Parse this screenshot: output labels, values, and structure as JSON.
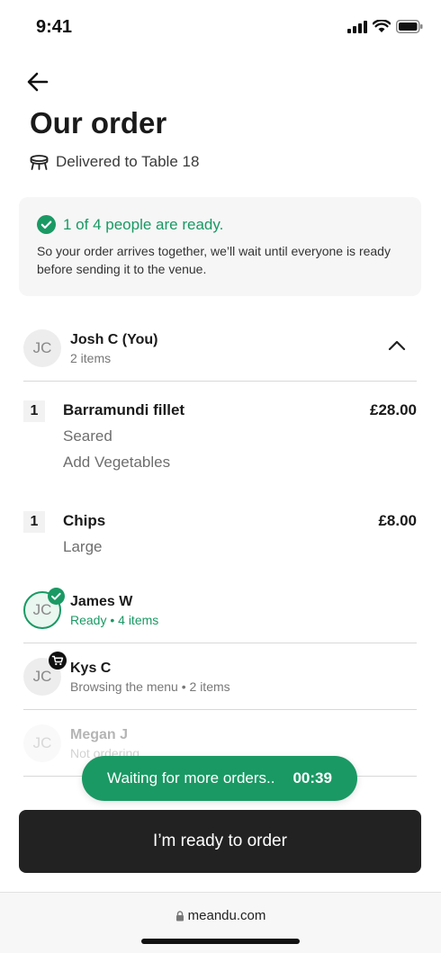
{
  "status_bar": {
    "time": "9:41"
  },
  "header": {
    "title": "Our order",
    "delivery": "Delivered to Table 18"
  },
  "ready_card": {
    "headline": "1 of 4 people are ready.",
    "description": "So your order arrives together, we’ll wait until everyone is ready before sending it to the venue."
  },
  "members": [
    {
      "initials": "JC",
      "name": "Josh C (You)",
      "status": "2 items",
      "expanded": true,
      "items": [
        {
          "qty": "1",
          "name": "Barramundi fillet",
          "price": "£28.00",
          "modifiers": [
            "Seared",
            "Add Vegetables"
          ]
        },
        {
          "qty": "1",
          "name": "Chips",
          "price": "£8.00",
          "modifiers": [
            "Large"
          ]
        }
      ]
    },
    {
      "initials": "JC",
      "name": "James W",
      "status": "Ready • 4 items",
      "state": "ready"
    },
    {
      "initials": "JC",
      "name": "Kys C",
      "status": "Browsing the menu • 2 items",
      "state": "browsing"
    },
    {
      "initials": "JC",
      "name": "Megan J",
      "status": "Not ordering",
      "state": "not-ordering"
    }
  ],
  "toast": {
    "text": "Waiting for more orders..",
    "timer": "00:39"
  },
  "cta": {
    "label": "I’m ready to order"
  },
  "browser": {
    "url": "meandu.com"
  },
  "colors": {
    "accent": "#1a9964",
    "dark": "#222222",
    "card_bg": "#f6f6f6"
  }
}
